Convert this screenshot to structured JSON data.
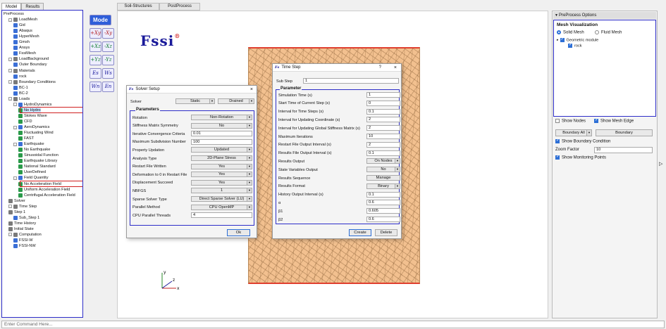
{
  "left_tabs": [
    "Model",
    "Results"
  ],
  "tree": [
    {
      "label": "PreProcess",
      "depth": 0,
      "toggle": ""
    },
    {
      "label": "LoadMesh",
      "depth": 1,
      "toggle": "-"
    },
    {
      "label": "Gid",
      "depth": 2
    },
    {
      "label": "Abaqus",
      "depth": 2
    },
    {
      "label": "HyperMesh",
      "depth": 2
    },
    {
      "label": "Gmsh",
      "depth": 2
    },
    {
      "label": "Ansys",
      "depth": 2
    },
    {
      "label": "FssiMesh",
      "depth": 2
    },
    {
      "label": "LoadBackground",
      "depth": 1,
      "toggle": "-"
    },
    {
      "label": "Outer Boundary",
      "depth": 2
    },
    {
      "label": "Materials",
      "depth": 1,
      "toggle": "-"
    },
    {
      "label": "rock",
      "depth": 2
    },
    {
      "label": "Boundary Conditions",
      "depth": 1,
      "toggle": "-"
    },
    {
      "label": "BC-1",
      "depth": 2
    },
    {
      "label": "BC-2",
      "depth": 2
    },
    {
      "label": "Loads",
      "depth": 1,
      "toggle": "-"
    },
    {
      "label": "HydroDynamics",
      "depth": 2,
      "toggle": "-"
    },
    {
      "label": "No Hydro",
      "depth": 3
    },
    {
      "label": "Stokes Wave",
      "depth": 3
    },
    {
      "label": "CFD",
      "depth": 3
    },
    {
      "label": "AeroDynamics",
      "depth": 2,
      "toggle": "-"
    },
    {
      "label": "Fluctuating Wind",
      "depth": 3
    },
    {
      "label": "FAST",
      "depth": 3
    },
    {
      "label": "Earthquake",
      "depth": 2,
      "toggle": "-"
    },
    {
      "label": "No Earthquake",
      "depth": 3
    },
    {
      "label": "Sinusoidal Function",
      "depth": 3
    },
    {
      "label": "Earthquake Library",
      "depth": 3
    },
    {
      "label": "National Standard",
      "depth": 3
    },
    {
      "label": "UserDefined",
      "depth": 3
    },
    {
      "label": "Field Quantity",
      "depth": 2,
      "toggle": "-"
    },
    {
      "label": "No Acceleration Field",
      "depth": 3
    },
    {
      "label": "Uniform Acceleration Field",
      "depth": 3
    },
    {
      "label": "Centrifugal Acceleration Field",
      "depth": 3
    },
    {
      "label": "Solver",
      "depth": 1
    },
    {
      "label": "Time Step",
      "depth": 1,
      "toggle": "-"
    },
    {
      "label": "Step 1",
      "depth": 1
    },
    {
      "label": "Sub_Step 1",
      "depth": 2
    },
    {
      "label": "Time History",
      "depth": 1
    },
    {
      "label": "Initial State",
      "depth": 1
    },
    {
      "label": "Computation",
      "depth": 1,
      "toggle": "-"
    },
    {
      "label": "FSSI-W",
      "depth": 2
    },
    {
      "label": "FSSI-NW",
      "depth": 2
    }
  ],
  "toolbar": {
    "mode_label": "Mode",
    "tools": [
      "+Xy",
      "-Xy",
      "+Xz",
      "-Xz",
      "+Yz",
      "-Yz",
      "Es",
      "Ws",
      "Wn",
      "En"
    ]
  },
  "main_tabs": [
    "Soil-Structures",
    "PostProcess"
  ],
  "logo": "Fssi",
  "axes": {
    "x": "x",
    "y": "y",
    "z": "z"
  },
  "solver_setup": {
    "title": "Solver Setup",
    "solver_label": "Solver",
    "solver_value": "Static",
    "solver_value2": "Drained",
    "group": "Parameters",
    "rows": [
      {
        "label": "Rotation",
        "value": "Non-Rotation",
        "type": "combo"
      },
      {
        "label": "Stiffness Matrix Symmetry",
        "value": "No",
        "type": "combo"
      },
      {
        "label": "Iterative Convergence Criteria",
        "value": "0.01",
        "type": "input"
      },
      {
        "label": "Maximum Subdivision Number",
        "value": "100",
        "type": "input"
      },
      {
        "label": "Property Updation",
        "value": "Updated",
        "type": "combo"
      },
      {
        "label": "Analysis Type",
        "value": "2D-Plane Stress",
        "type": "combo"
      },
      {
        "label": "Restart File Written",
        "value": "Yes",
        "type": "combo"
      },
      {
        "label": "Deformation to 0 in Restart File",
        "value": "Yes",
        "type": "combo"
      },
      {
        "label": "Displacement Succeed",
        "value": "Yes",
        "type": "combo"
      },
      {
        "label": "NBFGS",
        "value": "1",
        "type": "combo"
      },
      {
        "label": "Sparse Solver Type",
        "value": "Direct Sparse Solver (LU)",
        "type": "combo"
      },
      {
        "label": "Parallel Method",
        "value": "CPU OpenMP",
        "type": "combo"
      },
      {
        "label": "CPU Parallel Threads",
        "value": "4",
        "type": "input"
      }
    ],
    "ok": "Ok"
  },
  "time_step": {
    "title": "Time Step",
    "help": "?",
    "sub_step_label": "Sub Step",
    "sub_step_value": "1",
    "group": "Parameter",
    "rows": [
      {
        "label": "Simulation Time (s)",
        "value": "1",
        "type": "input"
      },
      {
        "label": "Start Time of Current Step (s)",
        "value": "0",
        "type": "input"
      },
      {
        "label": "Interval for Time Steps (s)",
        "value": "0.1",
        "type": "input"
      },
      {
        "label": "Interval for Updating Coordinate (s)",
        "value": "2",
        "type": "input"
      },
      {
        "label": "Interval for Updating Global Stiffness Matrix (s)",
        "value": "2",
        "type": "input"
      },
      {
        "label": "Maximum Iterations",
        "value": "10",
        "type": "input"
      },
      {
        "label": "Restart File Output Interval (s)",
        "value": "2",
        "type": "input"
      },
      {
        "label": "Results File Output Interval (s)",
        "value": "0.1",
        "type": "input"
      },
      {
        "label": "Results Output",
        "value": "On Nodes",
        "type": "combo"
      },
      {
        "label": "State Variables Output",
        "value": "No",
        "type": "combo"
      },
      {
        "label": "Results Sequence",
        "value": "Manage",
        "type": "button"
      },
      {
        "label": "Results Format",
        "value": "Binary",
        "type": "combo"
      },
      {
        "label": "History Output Interval (s)",
        "value": "0.1",
        "type": "input"
      },
      {
        "label": "α",
        "value": "0.6",
        "type": "input"
      },
      {
        "label": "β1",
        "value": "0.605",
        "type": "input"
      },
      {
        "label": "β2",
        "value": "0.6",
        "type": "input"
      }
    ],
    "create": "Create",
    "delete": "Delete"
  },
  "right_panel": {
    "title": "PreProcess Options",
    "section": "Mesh Visualization",
    "solid_mesh": "Solid Mesh",
    "fluid_mesh": "Fluid Mesh",
    "geo_module": "Geometric module",
    "rock": "rock",
    "show_nodes": "Show Nodes",
    "show_mesh_edge": "Show Mesh Edge",
    "boundary_all": "Boundary All",
    "boundary_btn": "Boundary",
    "show_bc": "Show Boundary Condition",
    "zoom_label": "Zoom Factor",
    "zoom_value": "10",
    "show_mp": "Show Monitoring Points"
  },
  "command_placeholder": "Enter Command Here..."
}
